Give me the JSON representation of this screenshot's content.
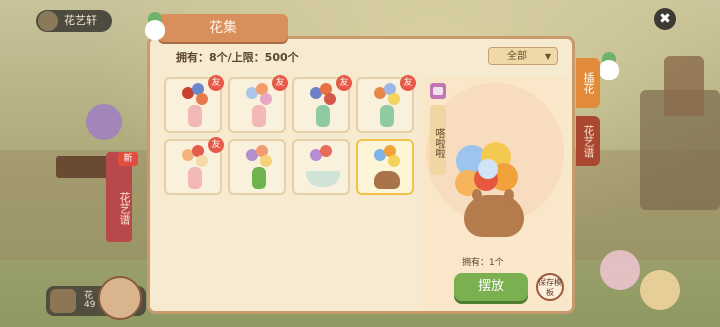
{
  "top_badge": {
    "label": "花艺轩"
  },
  "left_banner": {
    "label": "花艺谱",
    "new_tag": "新"
  },
  "bottom_bar": {
    "label": "花",
    "value": "49"
  },
  "panel": {
    "title": "花集",
    "owned_text": "拥有：8个/上限：500个",
    "filter": {
      "selected": "全部"
    }
  },
  "side_tabs": [
    {
      "label": "插花"
    },
    {
      "label": "花艺谱"
    }
  ],
  "collection": [
    {
      "tag": "友",
      "vase": "#f2b7b7",
      "colors": [
        "#c9402f",
        "#6a88c9",
        "#e67a4a"
      ]
    },
    {
      "tag": "友",
      "vase": "#f2b7b7",
      "colors": [
        "#a9c6e8",
        "#f39c6b",
        "#e8a8c5"
      ]
    },
    {
      "tag": "友",
      "vase": "#8fcaa2",
      "colors": [
        "#7080c8",
        "#e9713f",
        "#d4574a"
      ]
    },
    {
      "tag": "友",
      "vase": "#8fcaa2",
      "colors": [
        "#e7874b",
        "#9cb6e6",
        "#f3d25d"
      ]
    },
    {
      "tag": "友",
      "vase": "#f2b7b7",
      "colors": [
        "#f4b27c",
        "#e35c4c",
        "#f6d9a8"
      ]
    },
    {
      "tag": "",
      "vase": "#6fb34e",
      "colors": [
        "#b48fd0",
        "#f29b72",
        "#f7d07a"
      ]
    },
    {
      "tag": "",
      "vase": "#cfe3d6",
      "colors": [
        "#b78cd0",
        "#e96b5c"
      ]
    },
    {
      "tag": "",
      "vase": "#a9744a",
      "colors": [
        "#7db3e8",
        "#f2a23b",
        "#f3d35a"
      ]
    }
  ],
  "preview": {
    "name": "嗒啦啦",
    "owned": "拥有：1个",
    "place_label": "摆放",
    "save_label": "保存模板"
  },
  "colors": {
    "panel_bg": "#f6ead0",
    "accent_orange": "#e08a3a",
    "place_green": "#7bb051",
    "tag_red": "#e75a4a"
  }
}
